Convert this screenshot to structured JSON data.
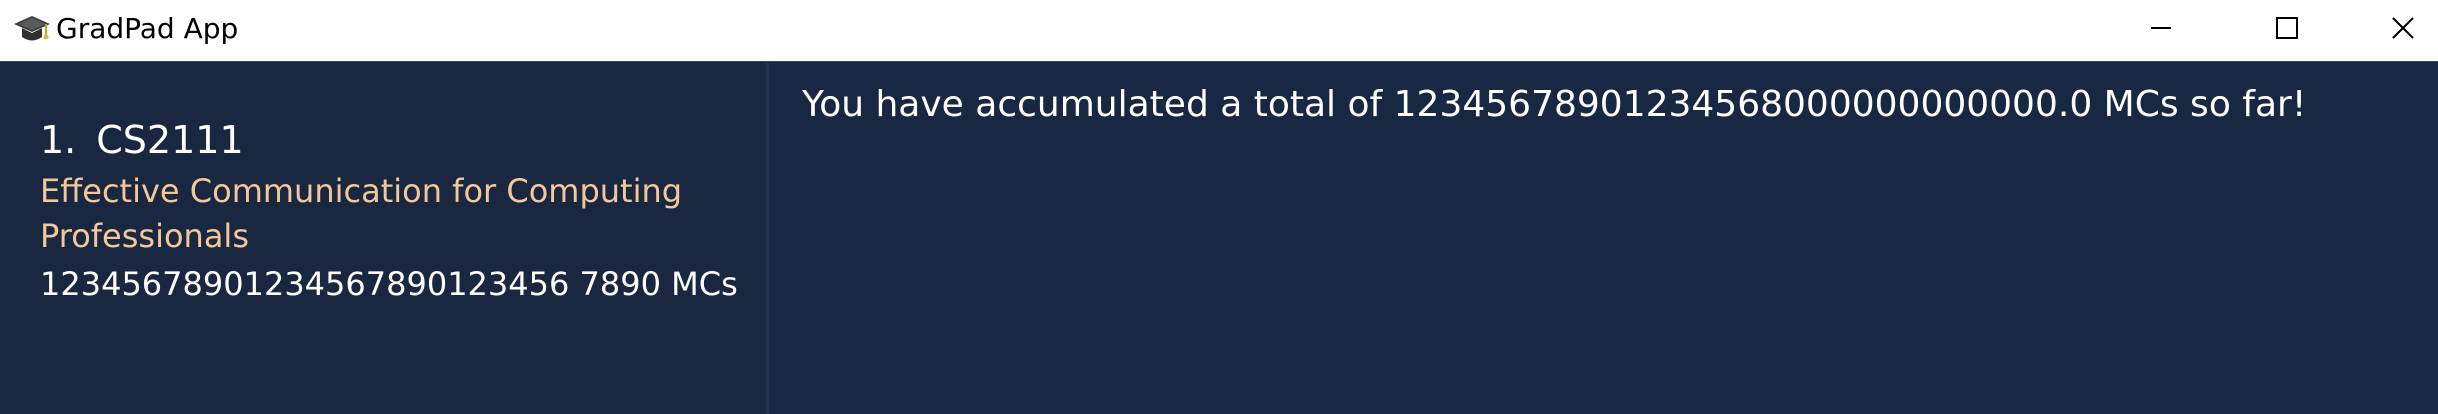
{
  "window": {
    "title": "GradPad App",
    "app_icon": "graduation-cap-icon",
    "controls": {
      "minimize_icon": "minimize-icon",
      "maximize_icon": "maximize-icon",
      "close_icon": "close-icon"
    }
  },
  "colors": {
    "titlebar_bg": "#ffffff",
    "panel_bg": "#182742",
    "module_title": "#f2c89a",
    "text": "#ffffff"
  },
  "module_list": [
    {
      "index": "1.",
      "code": "CS2111",
      "title": "Effective Communication for Computing Professionals",
      "mcs": "12345678901234567890123456 7890 MCs"
    }
  ],
  "summary": {
    "total_text": "You have accumulated a total of 12345678901234568000000000000.0 MCs so far!"
  }
}
